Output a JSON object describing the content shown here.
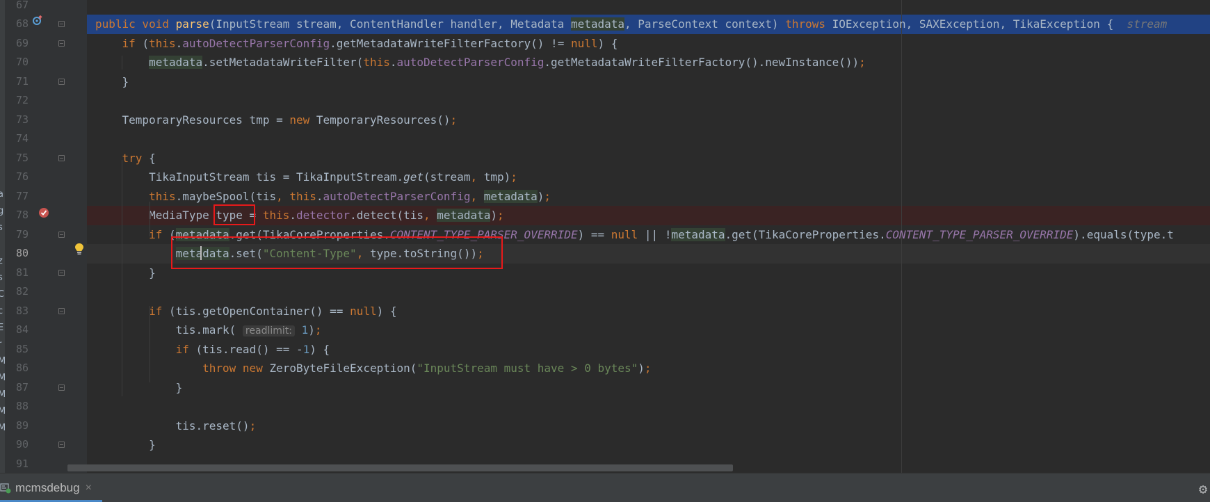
{
  "editor": {
    "lines": [
      {
        "num": "67"
      },
      {
        "num": "68",
        "code": [
          {
            "t": "public void ",
            "c": "kw"
          },
          {
            "t": "parse",
            "c": "fn"
          },
          {
            "t": "(InputStream stream, ContentHandler handler, Metadata "
          },
          {
            "t": "metadata",
            "c": "hl"
          },
          {
            "t": ", ParseContext context) "
          },
          {
            "t": "throws ",
            "c": "kw"
          },
          {
            "t": "IOException, SAXException, TikaException {  "
          },
          {
            "t": "stream",
            "c": "hint-ghost"
          }
        ]
      },
      {
        "num": "69",
        "code": [
          {
            "t": "    "
          },
          {
            "t": "if ",
            "c": "kw"
          },
          {
            "t": "("
          },
          {
            "t": "this",
            "c": "kw"
          },
          {
            "t": "."
          },
          {
            "t": "autoDetectParserConfig",
            "c": "fld"
          },
          {
            "t": ".getMetadataWriteFilterFactory() != "
          },
          {
            "t": "null",
            "c": "kw"
          },
          {
            "t": ") {"
          }
        ]
      },
      {
        "num": "70",
        "code": [
          {
            "t": "        "
          },
          {
            "t": "metadata",
            "c": "hl"
          },
          {
            "t": ".setMetadataWriteFilter("
          },
          {
            "t": "this",
            "c": "kw"
          },
          {
            "t": "."
          },
          {
            "t": "autoDetectParserConfig",
            "c": "fld"
          },
          {
            "t": ".getMetadataWriteFilterFactory().newInstance())"
          },
          {
            "t": ";",
            "c": "kw"
          }
        ]
      },
      {
        "num": "71",
        "code": [
          {
            "t": "    }"
          }
        ]
      },
      {
        "num": "72"
      },
      {
        "num": "73",
        "code": [
          {
            "t": "    TemporaryResources tmp = "
          },
          {
            "t": "new ",
            "c": "kw"
          },
          {
            "t": "TemporaryResources()"
          },
          {
            "t": ";",
            "c": "kw"
          }
        ]
      },
      {
        "num": "74"
      },
      {
        "num": "75",
        "code": [
          {
            "t": "    "
          },
          {
            "t": "try ",
            "c": "kw"
          },
          {
            "t": "{"
          }
        ]
      },
      {
        "num": "76",
        "code": [
          {
            "t": "        TikaInputStream tis = TikaInputStream."
          },
          {
            "t": "get",
            "c": "st"
          },
          {
            "t": "(stream"
          },
          {
            "t": ", ",
            "c": "kw"
          },
          {
            "t": "tmp)"
          },
          {
            "t": ";",
            "c": "kw"
          }
        ]
      },
      {
        "num": "77",
        "code": [
          {
            "t": "        "
          },
          {
            "t": "this",
            "c": "kw"
          },
          {
            "t": ".maybeSpool(tis"
          },
          {
            "t": ", ",
            "c": "kw"
          },
          {
            "t": "this",
            "c": "kw"
          },
          {
            "t": "."
          },
          {
            "t": "autoDetectParserConfig",
            "c": "fld"
          },
          {
            "t": ", ",
            "c": "kw"
          },
          {
            "t": "metadata",
            "c": "hl"
          },
          {
            "t": ")"
          },
          {
            "t": ";",
            "c": "kw"
          }
        ]
      },
      {
        "num": "78",
        "code": [
          {
            "t": "        MediaType type = "
          },
          {
            "t": "this",
            "c": "kw"
          },
          {
            "t": "."
          },
          {
            "t": "detector",
            "c": "fld"
          },
          {
            "t": ".detect(tis"
          },
          {
            "t": ", ",
            "c": "kw"
          },
          {
            "t": "metadata",
            "c": "hl"
          },
          {
            "t": ")"
          },
          {
            "t": ";",
            "c": "kw"
          }
        ]
      },
      {
        "num": "79",
        "code": [
          {
            "t": "        "
          },
          {
            "t": "if ",
            "c": "kw"
          },
          {
            "t": "("
          },
          {
            "t": "metadata",
            "c": "hl"
          },
          {
            "t": ".get(TikaCoreProperties."
          },
          {
            "t": "CONTENT_TYPE_PARSER_OVERRIDE",
            "c": "cst"
          },
          {
            "t": ") == "
          },
          {
            "t": "null ",
            "c": "kw"
          },
          {
            "t": "|| !"
          },
          {
            "t": "metadata",
            "c": "hl"
          },
          {
            "t": ".get(TikaCoreProperties."
          },
          {
            "t": "CONTENT_TYPE_PARSER_OVERRIDE",
            "c": "cst"
          },
          {
            "t": ").equals(type.t"
          }
        ]
      },
      {
        "num": "80",
        "code": [
          {
            "t": "            "
          },
          {
            "t": "metadata",
            "c": "hl"
          },
          {
            "t": ".set("
          },
          {
            "t": "\"Content-Type\"",
            "c": "str"
          },
          {
            "t": ", ",
            "c": "kw"
          },
          {
            "t": "type.toString())"
          },
          {
            "t": ";",
            "c": "kw"
          }
        ]
      },
      {
        "num": "81",
        "code": [
          {
            "t": "        }"
          }
        ]
      },
      {
        "num": "82"
      },
      {
        "num": "83",
        "code": [
          {
            "t": "        "
          },
          {
            "t": "if ",
            "c": "kw"
          },
          {
            "t": "(tis.getOpenContainer() == "
          },
          {
            "t": "null",
            "c": "kw"
          },
          {
            "t": ") {"
          }
        ]
      },
      {
        "num": "84",
        "code": [
          {
            "t": "            tis.mark( "
          },
          {
            "t": "readlimit:",
            "c": "hint"
          },
          {
            "t": " "
          },
          {
            "t": "1",
            "c": "num"
          },
          {
            "t": ")"
          },
          {
            "t": ";",
            "c": "kw"
          }
        ]
      },
      {
        "num": "85",
        "code": [
          {
            "t": "            "
          },
          {
            "t": "if ",
            "c": "kw"
          },
          {
            "t": "(tis.read() == -"
          },
          {
            "t": "1",
            "c": "num"
          },
          {
            "t": ") {"
          }
        ]
      },
      {
        "num": "86",
        "code": [
          {
            "t": "                "
          },
          {
            "t": "throw new ",
            "c": "kw"
          },
          {
            "t": "ZeroByteFileException("
          },
          {
            "t": "\"InputStream must have > 0 bytes\"",
            "c": "str"
          },
          {
            "t": ")"
          },
          {
            "t": ";",
            "c": "kw"
          }
        ]
      },
      {
        "num": "87",
        "code": [
          {
            "t": "            }"
          }
        ]
      },
      {
        "num": "88"
      },
      {
        "num": "89",
        "code": [
          {
            "t": "            tis.reset()"
          },
          {
            "t": ";",
            "c": "kw"
          }
        ]
      },
      {
        "num": "90",
        "code": [
          {
            "t": "        }"
          }
        ]
      },
      {
        "num": "91"
      }
    ]
  },
  "sidebar_fragments": [
    "a",
    "g",
    "s",
    "j",
    "z",
    "s",
    "C",
    "c",
    "E",
    "r",
    "M",
    "M",
    "M",
    "M",
    "M"
  ],
  "run_tab": {
    "label": "mcmsdebug",
    "close_glyph": "×",
    "icon": "debug-run-icon"
  },
  "colors": {
    "selection": "#214283",
    "marker": "#e8191a",
    "keyword": "#cc7832",
    "string": "#6a8759"
  }
}
